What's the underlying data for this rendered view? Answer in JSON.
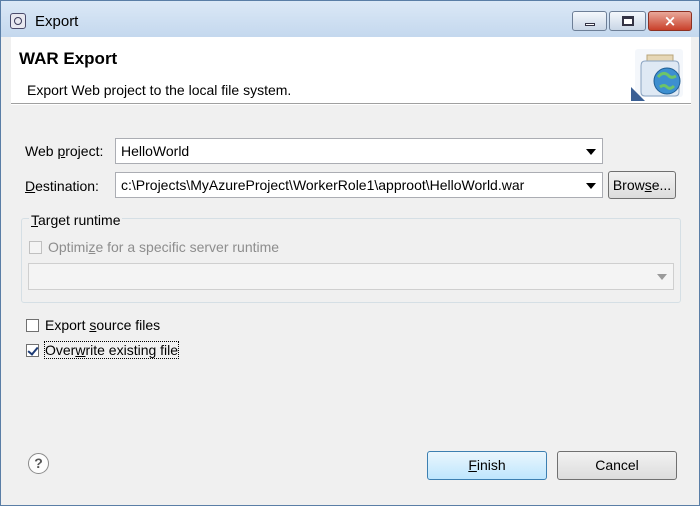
{
  "window": {
    "title": "Export",
    "close_glyph": "×"
  },
  "header": {
    "title": "WAR Export",
    "description": "Export Web project to the local file system.",
    "icon": "war-export-banner-icon"
  },
  "form": {
    "web_project": {
      "label_pre": "Web ",
      "label_mnemonic": "p",
      "label_post": "roject:",
      "value": "HelloWorld"
    },
    "destination": {
      "label_mnemonic": "D",
      "label_post": "estination:",
      "value": "c:\\Projects\\MyAzureProject\\WorkerRole1\\approot\\HelloWorld.war"
    },
    "browse": {
      "pre": "Brow",
      "mnemonic": "s",
      "post": "e..."
    }
  },
  "target_runtime": {
    "title_mnemonic": "T",
    "title_post": "arget runtime",
    "optimize": {
      "pre": "Optimi",
      "mnemonic": "z",
      "post": "e for a specific server runtime",
      "checked": false,
      "enabled": false
    },
    "runtime_value": ""
  },
  "options": {
    "export_source": {
      "pre": "Export ",
      "mnemonic": "s",
      "post": "ource files",
      "checked": false
    },
    "overwrite": {
      "pre": "Over",
      "mnemonic": "w",
      "post": "rite existing file",
      "checked": true
    }
  },
  "buttons": {
    "help_glyph": "?",
    "finish": {
      "mnemonic": "F",
      "post": "inish"
    },
    "cancel": "Cancel"
  }
}
